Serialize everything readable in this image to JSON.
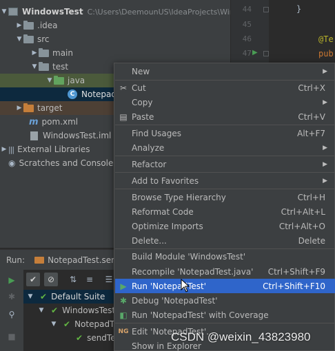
{
  "tree": {
    "project": {
      "name": "WindowsTest",
      "path": "C:\\Users\\DeemounUS\\IdeaProjects\\Wind"
    },
    "idea": ".idea",
    "src": "src",
    "main": "main",
    "test": "test",
    "java": "java",
    "notepad_test": "NotepadTest",
    "target": "target",
    "pom": "pom.xml",
    "iml": "WindowsTest.iml",
    "external_libraries": "External Libraries",
    "scratches": "Scratches and Consoles"
  },
  "editor": {
    "line_numbers": [
      "44",
      "45",
      "46",
      "47"
    ],
    "code_lines": [
      "}",
      "",
      "@Te",
      "pub"
    ]
  },
  "run": {
    "label": "Run:",
    "tab_label": "NotepadTest.send",
    "tree": [
      "Default Suite",
      "WindowsTest",
      "NotepadTe",
      "sendTe"
    ]
  },
  "menu": {
    "items": [
      {
        "label": "New",
        "shortcut": "",
        "submenu": true,
        "icon": ""
      },
      {
        "label": "Cut",
        "shortcut": "Ctrl+X",
        "submenu": false,
        "icon": "scissors-icon"
      },
      {
        "label": "Copy",
        "shortcut": "",
        "submenu": true,
        "icon": ""
      },
      {
        "label": "Paste",
        "shortcut": "Ctrl+V",
        "submenu": false,
        "icon": "clipboard-icon"
      },
      {
        "label": "Find Usages",
        "shortcut": "Alt+F7",
        "submenu": false,
        "icon": ""
      },
      {
        "label": "Analyze",
        "shortcut": "",
        "submenu": true,
        "icon": ""
      },
      {
        "label": "Refactor",
        "shortcut": "",
        "submenu": true,
        "icon": ""
      },
      {
        "label": "Add to Favorites",
        "shortcut": "",
        "submenu": true,
        "icon": ""
      },
      {
        "label": "Browse Type Hierarchy",
        "shortcut": "Ctrl+H",
        "submenu": false,
        "icon": ""
      },
      {
        "label": "Reformat Code",
        "shortcut": "Ctrl+Alt+L",
        "submenu": false,
        "icon": ""
      },
      {
        "label": "Optimize Imports",
        "shortcut": "Ctrl+Alt+O",
        "submenu": false,
        "icon": ""
      },
      {
        "label": "Delete...",
        "shortcut": "Delete",
        "submenu": false,
        "icon": ""
      },
      {
        "label": "Build Module 'WindowsTest'",
        "shortcut": "",
        "submenu": false,
        "icon": ""
      },
      {
        "label": "Recompile 'NotepadTest.java'",
        "shortcut": "Ctrl+Shift+F9",
        "submenu": false,
        "icon": ""
      },
      {
        "label": "Run 'NotepadTest'",
        "shortcut": "Ctrl+Shift+F10",
        "submenu": false,
        "icon": "run-icon",
        "selected": true
      },
      {
        "label": "Debug 'NotepadTest'",
        "shortcut": "",
        "submenu": false,
        "icon": "debug-icon"
      },
      {
        "label": "Run 'NotepadTest' with Coverage",
        "shortcut": "",
        "submenu": false,
        "icon": "coverage-icon"
      },
      {
        "label": "Edit 'NotepadTest'...",
        "shortcut": "",
        "submenu": false,
        "icon": "testng-icon"
      },
      {
        "label": "Show in Explorer",
        "shortcut": "",
        "submenu": false,
        "icon": ""
      }
    ]
  },
  "watermark": "CSDN @weixin_43823980",
  "colors": {
    "selection_blue": "#2f65ca",
    "run_green": "#499c54",
    "tree_selection": "#0d293e"
  }
}
